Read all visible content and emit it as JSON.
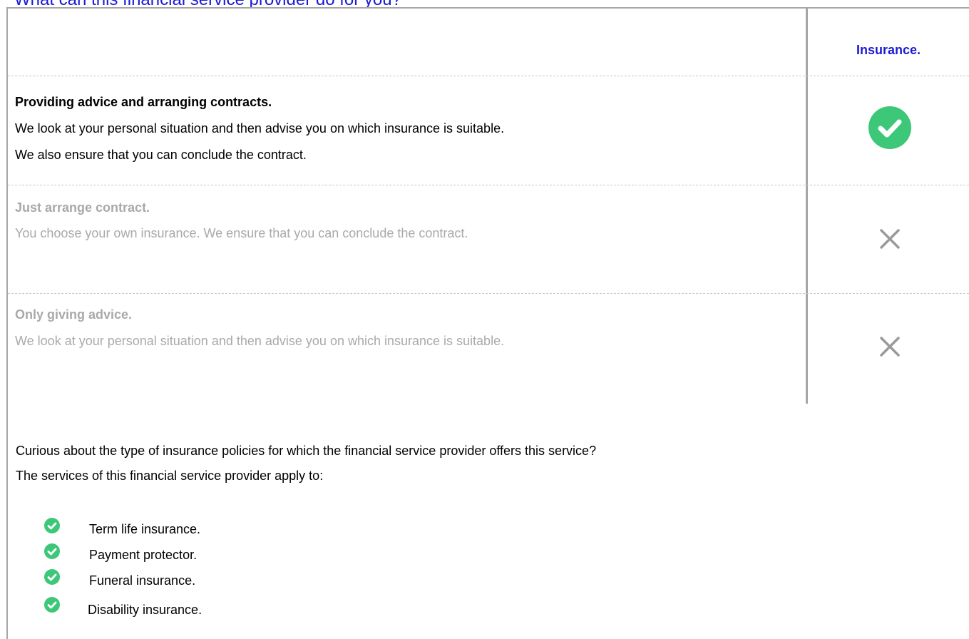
{
  "page": {
    "heading": "What can this financial service provider do for you?"
  },
  "table": {
    "column_header": "Insurance.",
    "rows": [
      {
        "title": "Providing advice and arranging contracts.",
        "lines": [
          "We look at your personal situation and then advise you on which insurance is suitable.",
          "We also ensure that you can conclude the contract."
        ],
        "status": "check-icon",
        "available": true
      },
      {
        "title": "Just arrange contract.",
        "lines": [
          "You choose your own insurance. We ensure that you can conclude the contract."
        ],
        "status": "cross-icon",
        "available": false
      },
      {
        "title": "Only giving advice.",
        "lines": [
          "We look at your personal situation and then advise you on which insurance is suitable."
        ],
        "status": "cross-icon",
        "available": false
      }
    ]
  },
  "info": {
    "question": "Curious about the type of insurance policies for which the financial service provider offers this service?",
    "intro": "The services of this financial service provider apply to:",
    "services": [
      "Term life insurance.",
      "Payment protector.",
      "Funeral insurance.",
      "Disability insurance."
    ]
  },
  "colors": {
    "accent": "#1a1ad6",
    "check": "#3cc878",
    "cross": "#9a9a9a",
    "muted_text": "#a9a9a9",
    "border": "#a6a6a6"
  }
}
